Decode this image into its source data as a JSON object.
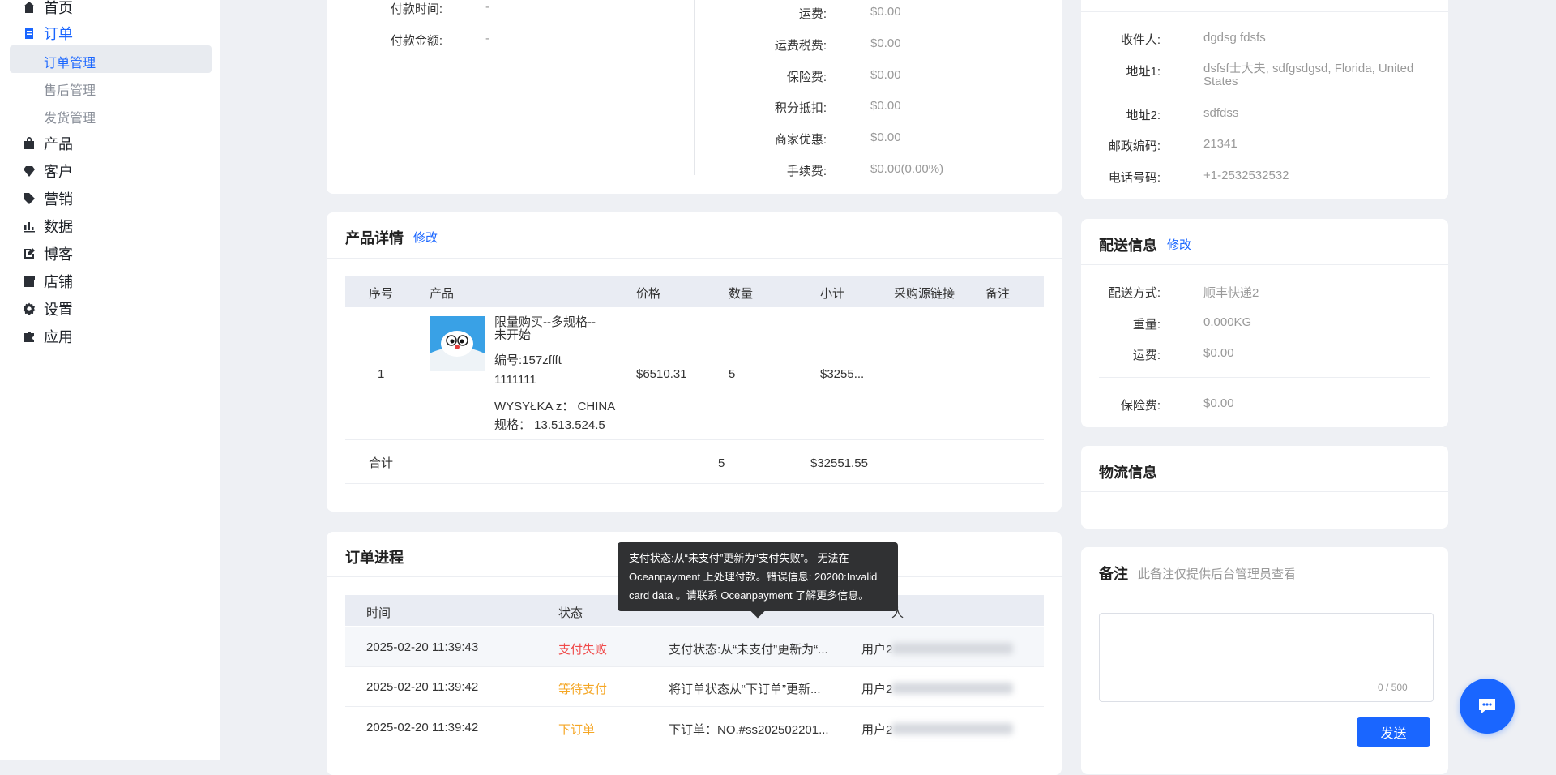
{
  "sidebar": {
    "home": "首页",
    "orders": "订单",
    "orders_sub": [
      "订单管理",
      "售后管理",
      "发货管理"
    ],
    "products": "产品",
    "customers": "客户",
    "marketing": "营销",
    "data": "数据",
    "blog": "博客",
    "store": "店铺",
    "settings": "设置",
    "apps": "应用"
  },
  "payment": {
    "pay_time_label": "付款时间:",
    "pay_time_value": "-",
    "pay_amount_label": "付款金额:",
    "pay_amount_value": "-",
    "fees": [
      {
        "label": "运费:",
        "value": "$0.00"
      },
      {
        "label": "运费税费:",
        "value": "$0.00"
      },
      {
        "label": "保险费:",
        "value": "$0.00"
      },
      {
        "label": "积分抵扣:",
        "value": "$0.00"
      },
      {
        "label": "商家优惠:",
        "value": "$0.00"
      },
      {
        "label": "手续费:",
        "value": "$0.00(0.00%)"
      }
    ]
  },
  "product_detail": {
    "title": "产品详情",
    "edit": "修改",
    "headers": [
      "序号",
      "产品",
      "价格",
      "数量",
      "小计",
      "采购源链接",
      "备注"
    ],
    "row": {
      "index": "1",
      "name_line1": "限量购买--多规格--",
      "name_line2": "未开始",
      "sku": "编号:157zffft",
      "code": "1111111",
      "ship_from": "WYSYŁKA z： CHINA",
      "spec": "规格： 13.513.524.5",
      "price": "$6510.31",
      "qty": "5",
      "subtotal": "$3255..."
    },
    "total_label": "合计",
    "total_qty": "5",
    "total_amount": "$32551.55"
  },
  "progress": {
    "title": "订单进程",
    "headers": [
      "时间",
      "状态",
      "",
      "人"
    ],
    "rows": [
      {
        "time": "2025-02-20 11:39:43",
        "status": "支付失败",
        "desc": "支付状态:从“未支付”更新为“...",
        "user": "用户2"
      },
      {
        "time": "2025-02-20 11:39:42",
        "status": "等待支付",
        "desc": "将订单状态从“下订单”更新...",
        "user": "用户2"
      },
      {
        "time": "2025-02-20 11:39:42",
        "status": "下订单",
        "desc": "下订单：NO.#ss202502201...",
        "user": "用户2"
      }
    ],
    "tooltip": "支付状态:从“未支付”更新为“支付失败”。 无法在 Oceanpayment 上处理付款。错误信息: 20200:Invalid card data 。请联系 Oceanpayment 了解更多信息。"
  },
  "address": {
    "fields": [
      {
        "label": "收件人:",
        "value": "dgdsg fdsfs"
      },
      {
        "label": "地址1:",
        "value": "dsfsf士大夫, sdfgsdgsd, Florida, United States"
      },
      {
        "label": "地址2:",
        "value": "sdfdss"
      },
      {
        "label": "邮政编码:",
        "value": "21341"
      },
      {
        "label": "电话号码:",
        "value": "+1-2532532532"
      }
    ]
  },
  "shipping": {
    "title": "配送信息",
    "edit": "修改",
    "fields": [
      {
        "label": "配送方式:",
        "value": "顺丰快递2"
      },
      {
        "label": "重量:",
        "value": "0.000KG"
      },
      {
        "label": "运费:",
        "value": "$0.00"
      },
      {
        "label": "保险费:",
        "value": "$0.00"
      }
    ]
  },
  "logistics": {
    "title": "物流信息"
  },
  "remark": {
    "title": "备注",
    "hint": "此备注仅提供后台管理员查看",
    "counter": "0 / 500",
    "send": "发送"
  },
  "colors": {
    "accent": "#1a66ff",
    "fail": "#f04a4a",
    "warn": "#f5a623"
  }
}
